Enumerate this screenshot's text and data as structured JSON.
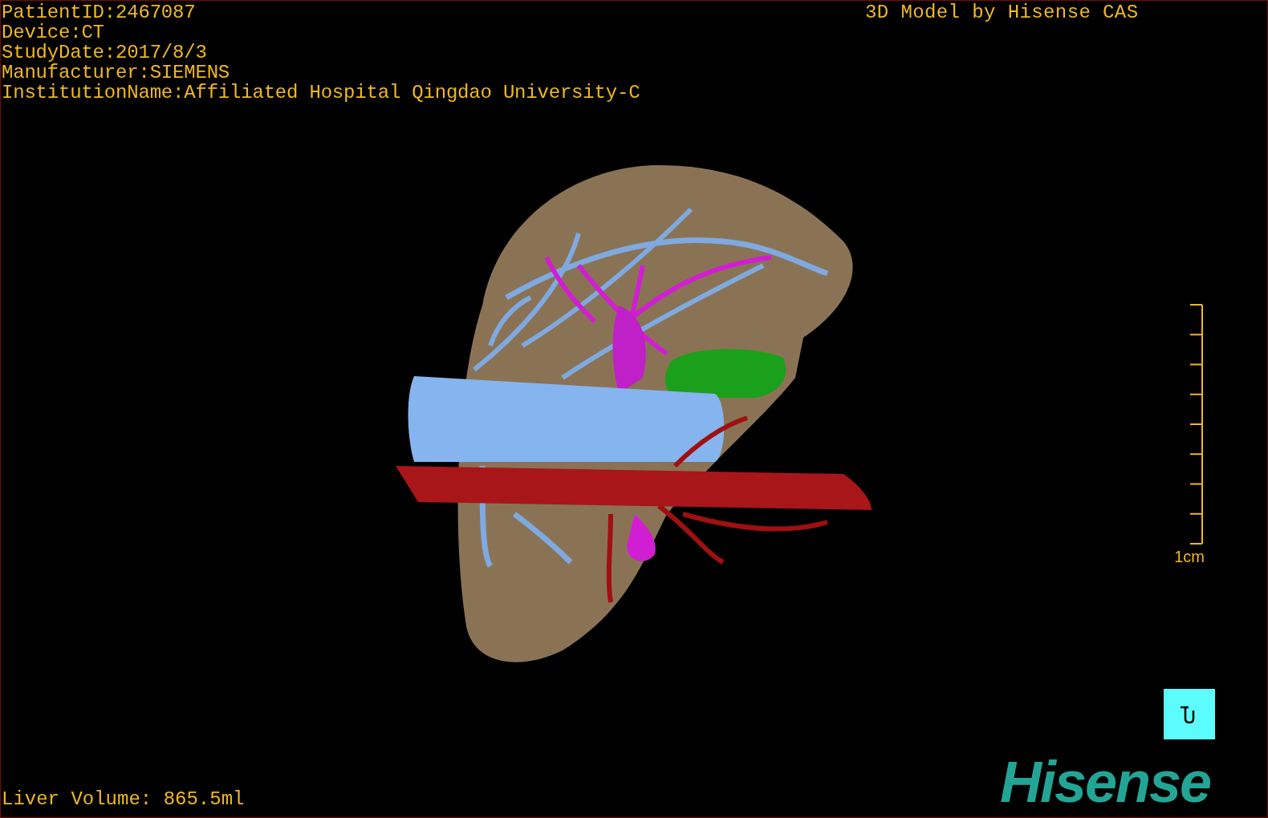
{
  "patient_info": [
    "PatientID:2467087",
    "Device:CT",
    "StudyDate:2017/8/3",
    "Manufacturer:SIEMENS",
    "InstitutionName:Affiliated Hospital Qingdao University-C"
  ],
  "credit": "3D Model by Hisense CAS",
  "scale_bar": {
    "label": "1cm"
  },
  "volume": "Liver Volume: 865.5ml",
  "logo": "Hisense"
}
